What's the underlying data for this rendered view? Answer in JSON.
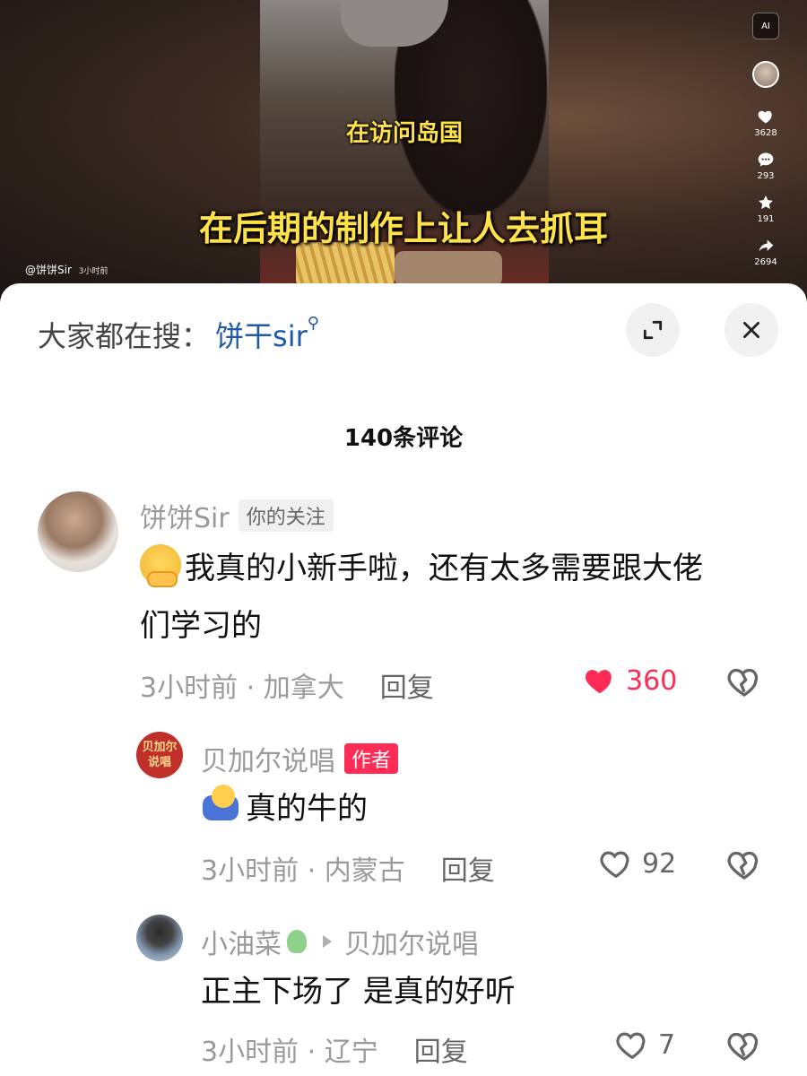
{
  "video": {
    "subtitle_small": "在访问岛国",
    "subtitle_large": "在后期的制作上让人去抓耳",
    "author_handle": "@饼饼Sir",
    "author_time": "3小时前",
    "ai_label": "AI",
    "rail": {
      "likes": "3628",
      "comments": "293",
      "favorites": "191",
      "shares": "2694"
    }
  },
  "sheet": {
    "search_prefix": "大家都在搜：",
    "search_query": "饼干sir",
    "comment_count": "140条评论"
  },
  "comments": [
    {
      "name": "饼饼Sir",
      "tag": "你的关注",
      "text_line1": "我真的小新手啦，还有太多需要跟大佬",
      "text_line2": "们学习的",
      "emoji": "shy-face-emoji",
      "time_location": "3小时前 · 加拿大",
      "reply": "回复",
      "likes": "360",
      "liked": true
    },
    {
      "name": "贝加尔说唱",
      "avatar_text": "贝加尔说唱",
      "tag": "作者",
      "text": "真的牛的",
      "emoji": "hug-emoji",
      "time_location": "3小时前 · 内蒙古",
      "reply": "回复",
      "likes": "92",
      "liked": false
    },
    {
      "name": "小油菜",
      "reply_to": "贝加尔说唱",
      "text": "正主下场了 是真的好听",
      "time_location": "3小时前 · 辽宁",
      "reply": "回复",
      "likes": "7",
      "liked": false
    }
  ],
  "colors": {
    "accent_like": "#fe2c55",
    "author_tag": "#ff2d55",
    "query_blue": "#1f5aa6",
    "subtitle_yellow": "#ffe14a"
  }
}
